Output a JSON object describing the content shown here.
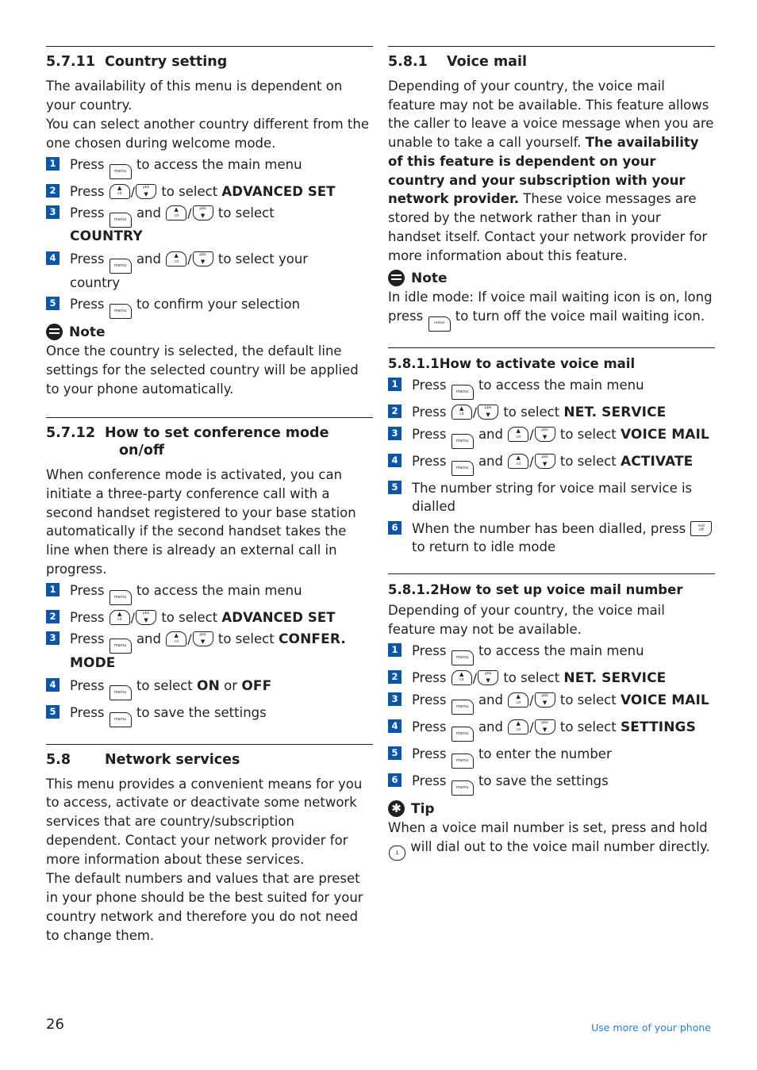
{
  "page": {
    "number": "26",
    "footer": "Use more of your phone"
  },
  "left": {
    "s5711": {
      "num": "5.7.11",
      "title": "Country setting",
      "p1": "The availability of this menu is dependent on your country.",
      "p2": "You can select another country different from the one chosen during welcome mode.",
      "steps": [
        {
          "n": "1",
          "pre": "Press",
          "post": "to access the main menu"
        },
        {
          "n": "2",
          "pre": "Press",
          "mid": "to select",
          "bold": "ADVANCED SET"
        },
        {
          "n": "3",
          "pre": "Press",
          "and": "and",
          "mid": "to select",
          "bold": "COUNTRY"
        },
        {
          "n": "4",
          "pre": "Press",
          "and": "and",
          "mid": "to select your",
          "bold": "country"
        },
        {
          "n": "5",
          "pre": "Press",
          "post": "to confirm your selection"
        }
      ],
      "note_label": "Note",
      "note_text": "Once the country is selected, the default line settings for the selected country will be applied to your phone automatically."
    },
    "s5712": {
      "num": "5.7.12",
      "title": "How to set conference mode",
      "title2": "on/off",
      "p1": "When conference mode is activated, you can initiate a three-party conference call with a second handset registered to your base station automatically if the second handset takes the line when there is already an external call in progress.",
      "steps": [
        {
          "n": "1",
          "pre": "Press",
          "post": "to access the main menu"
        },
        {
          "n": "2",
          "pre": "Press",
          "mid": "to select",
          "bold": "ADVANCED SET"
        },
        {
          "n": "3",
          "pre": "Press",
          "and": "and",
          "mid": "to select",
          "bold": "CONFER. MODE"
        },
        {
          "n": "4",
          "pre": "Press",
          "mid": "to select",
          "bold": "ON",
          "or": "or",
          "bold2": "OFF"
        },
        {
          "n": "5",
          "pre": "Press",
          "post": "to save the settings"
        }
      ]
    },
    "s58": {
      "num": "5.8",
      "title": "Network services",
      "p1": "This menu provides a convenient means for you to access, activate or deactivate some network services that are country/subscription dependent. Contact your network provider for more information about these services.",
      "p2": "The default numbers and values that are preset in your phone should be the best suited for your country network and therefore you do not need to change them."
    }
  },
  "right": {
    "s581": {
      "num": "5.8.1",
      "title": "Voice mail",
      "p1a": "Depending of your country, the voice mail feature may not be available. This feature allows the caller to leave a voice message when you are unable to take a call yourself. ",
      "p1b": "The availability of this feature is dependent on your country and your subscription with your network provider.",
      "p1c": " These voice messages are stored by the network rather than in your handset itself. Contact your network provider for more information about this feature.",
      "note_label": "Note",
      "note_a": "In idle mode: If voice mail waiting icon is on, long press",
      "note_b": "to turn off the voice mail waiting icon."
    },
    "s5811": {
      "num": "5.8.1.1",
      "title": "How to activate voice mail",
      "steps": [
        {
          "n": "1",
          "pre": "Press",
          "post": "to access the main menu"
        },
        {
          "n": "2",
          "pre": "Press",
          "mid": "to select",
          "bold": "NET. SERVICE"
        },
        {
          "n": "3",
          "pre": "Press",
          "and": "and",
          "mid": "to select",
          "bold": "VOICE MAIL"
        },
        {
          "n": "4",
          "pre": "Press",
          "and": "and",
          "mid": "to select",
          "bold": "ACTIVATE"
        },
        {
          "n": "5",
          "text": "The number string for voice mail service is dialled"
        },
        {
          "n": "6",
          "pre": "When the number has been dialled, press",
          "post": "to return to idle mode"
        }
      ]
    },
    "s5812": {
      "num": "5.8.1.2",
      "title": "How to set up voice mail number",
      "p1": "Depending of your country, the voice mail feature may not be available.",
      "steps": [
        {
          "n": "1",
          "pre": "Press",
          "post": "to access the main menu"
        },
        {
          "n": "2",
          "pre": "Press",
          "mid": "to select",
          "bold": "NET. SERVICE"
        },
        {
          "n": "3",
          "pre": "Press",
          "and": "and",
          "mid": "to select",
          "bold": "VOICE MAIL"
        },
        {
          "n": "4",
          "pre": "Press",
          "and": "and",
          "mid": "to select",
          "bold": "SETTINGS"
        },
        {
          "n": "5",
          "pre": "Press",
          "post": "to enter the number"
        },
        {
          "n": "6",
          "pre": "Press",
          "post": "to save the settings"
        }
      ],
      "tip_label": "Tip",
      "tip_a": "When a voice mail number is set, press and hold",
      "tip_b": "will dial out to the voice mail number directly."
    }
  },
  "keys": {
    "menu": "menu",
    "up_label": "cd",
    "down_label": "pbk",
    "redial": "redial",
    "off_l1": "exit",
    "off_l2": "off",
    "one": "1"
  },
  "colors": {
    "bullet": "#0d55a5",
    "footer": "#2d7dc4",
    "text": "#231f20"
  }
}
